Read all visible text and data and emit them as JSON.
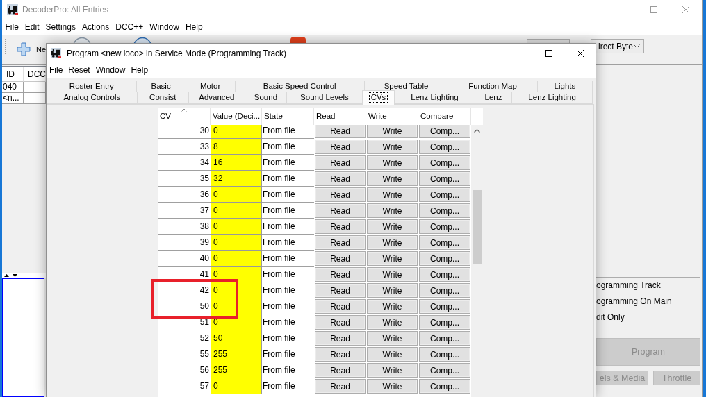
{
  "main_window": {
    "title": "DecoderPro: All Entries",
    "active": false,
    "menu": [
      "File",
      "Edit",
      "Settings",
      "Actions",
      "DCC++",
      "Window",
      "Help"
    ],
    "toolbar": {
      "new_button": "Ne",
      "mode_dropdown": "irect Byte"
    },
    "roster_table": {
      "columns": [
        "ID",
        "DCC"
      ],
      "rows": [
        {
          "id": "040"
        },
        {
          "id": "<n..."
        }
      ]
    },
    "mode_options": [
      "ogramming Track",
      "ogramming On Main",
      "dit Only"
    ],
    "buttons": [
      {
        "kind": "large",
        "label": "Program",
        "disabled": true
      },
      {
        "kind": "small",
        "label": "els & Media",
        "disabled": true
      },
      {
        "kind": "small",
        "label": "Throttle",
        "disabled": true
      }
    ]
  },
  "program_window": {
    "title": "Program <new loco> in Service Mode (Programming Track)",
    "active": true,
    "menu": [
      "File",
      "Reset",
      "Window",
      "Help"
    ],
    "tab_rows": [
      [
        {
          "label": "Roster Entry",
          "selected": false
        },
        {
          "label": "Basic",
          "selected": false
        },
        {
          "label": "Motor",
          "selected": false
        },
        {
          "label": "Basic Speed Control",
          "selected": false
        },
        {
          "label": "Speed Table",
          "selected": false
        },
        {
          "label": "Function Map",
          "selected": false
        },
        {
          "label": "Lights",
          "selected": false
        }
      ],
      [
        {
          "label": "Analog Controls",
          "selected": false
        },
        {
          "label": "Consist",
          "selected": false
        },
        {
          "label": "Advanced",
          "selected": false
        },
        {
          "label": "Sound",
          "selected": false
        },
        {
          "label": "Sound Levels",
          "selected": false
        },
        {
          "label": "CVs",
          "selected": true
        },
        {
          "label": "Lenz Lighting",
          "selected": false
        },
        {
          "label": "Lenz",
          "selected": false
        },
        {
          "label": "Lenz Lighting",
          "selected": false
        }
      ]
    ],
    "cv_table": {
      "columns": [
        {
          "label": "CV",
          "sorted": true
        },
        {
          "label": "Value (Deci...",
          "sorted": false
        },
        {
          "label": "State",
          "sorted": false
        },
        {
          "label": "Read",
          "sorted": false
        },
        {
          "label": "Write",
          "sorted": false
        },
        {
          "label": "Compare",
          "sorted": false
        }
      ],
      "rows": [
        {
          "cv": "30",
          "value": "0",
          "state": "From file",
          "read": "Read",
          "write": "Write",
          "compare": "Comp..."
        },
        {
          "cv": "33",
          "value": "8",
          "state": "From file",
          "read": "Read",
          "write": "Write",
          "compare": "Comp..."
        },
        {
          "cv": "34",
          "value": "16",
          "state": "From file",
          "read": "Read",
          "write": "Write",
          "compare": "Comp..."
        },
        {
          "cv": "35",
          "value": "32",
          "state": "From file",
          "read": "Read",
          "write": "Write",
          "compare": "Comp..."
        },
        {
          "cv": "36",
          "value": "0",
          "state": "From file",
          "read": "Read",
          "write": "Write",
          "compare": "Comp..."
        },
        {
          "cv": "37",
          "value": "0",
          "state": "From file",
          "read": "Read",
          "write": "Write",
          "compare": "Comp..."
        },
        {
          "cv": "38",
          "value": "0",
          "state": "From file",
          "read": "Read",
          "write": "Write",
          "compare": "Comp..."
        },
        {
          "cv": "39",
          "value": "0",
          "state": "From file",
          "read": "Read",
          "write": "Write",
          "compare": "Comp..."
        },
        {
          "cv": "40",
          "value": "0",
          "state": "From file",
          "read": "Read",
          "write": "Write",
          "compare": "Comp..."
        },
        {
          "cv": "41",
          "value": "0",
          "state": "From file",
          "read": "Read",
          "write": "Write",
          "compare": "Comp..."
        },
        {
          "cv": "42",
          "value": "0",
          "state": "From file",
          "read": "Read",
          "write": "Write",
          "compare": "Comp..."
        },
        {
          "cv": "50",
          "value": "0",
          "state": "From file",
          "read": "Read",
          "write": "Write",
          "compare": "Comp..."
        },
        {
          "cv": "51",
          "value": "0",
          "state": "From file",
          "read": "Read",
          "write": "Write",
          "compare": "Comp..."
        },
        {
          "cv": "52",
          "value": "50",
          "state": "From file",
          "read": "Read",
          "write": "Write",
          "compare": "Comp..."
        },
        {
          "cv": "55",
          "value": "255",
          "state": "From file",
          "read": "Read",
          "write": "Write",
          "compare": "Comp..."
        },
        {
          "cv": "56",
          "value": "255",
          "state": "From file",
          "read": "Read",
          "write": "Write",
          "compare": "Comp..."
        },
        {
          "cv": "57",
          "value": "0",
          "state": "From file",
          "read": "Read",
          "write": "Write",
          "compare": "Comp..."
        }
      ]
    }
  }
}
